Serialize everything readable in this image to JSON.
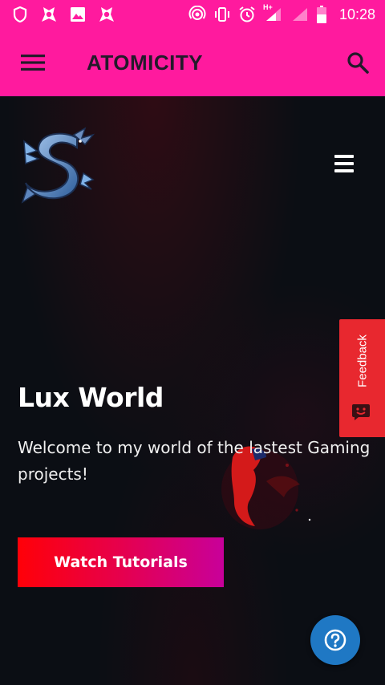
{
  "status_bar": {
    "time": "10:28",
    "network_label": "H+",
    "left_icons": [
      "shield-icon",
      "app-notification-icon",
      "image-icon",
      "app-notification-icon"
    ],
    "right_icons": [
      "hotspot-icon",
      "vibrate-icon",
      "alarm-icon",
      "signal-icon",
      "signal-icon",
      "battery-icon"
    ]
  },
  "app_bar": {
    "title": "ATOMICITY",
    "menu_icon": "hamburger-menu-icon",
    "search_icon": "search-icon"
  },
  "hero": {
    "logo": "dragon-s-logo",
    "menu_icon": "hamburger-menu-icon",
    "title": "Lux World",
    "subtitle": "Welcome to my world of the lastest Gaming projects!",
    "cta_label": "Watch Tutorials"
  },
  "feedback_tab": {
    "label": "Feedback",
    "icon": "chat-face-icon"
  },
  "help_button": {
    "icon": "question-mark-icon"
  },
  "colors": {
    "brand_pink": "#ff1a9e",
    "background": "#0b0e14",
    "feedback_red": "#e8282f",
    "help_blue": "#1f78c4",
    "cta_gradient_start": "#ff0008",
    "cta_gradient_end": "#c8009a"
  }
}
